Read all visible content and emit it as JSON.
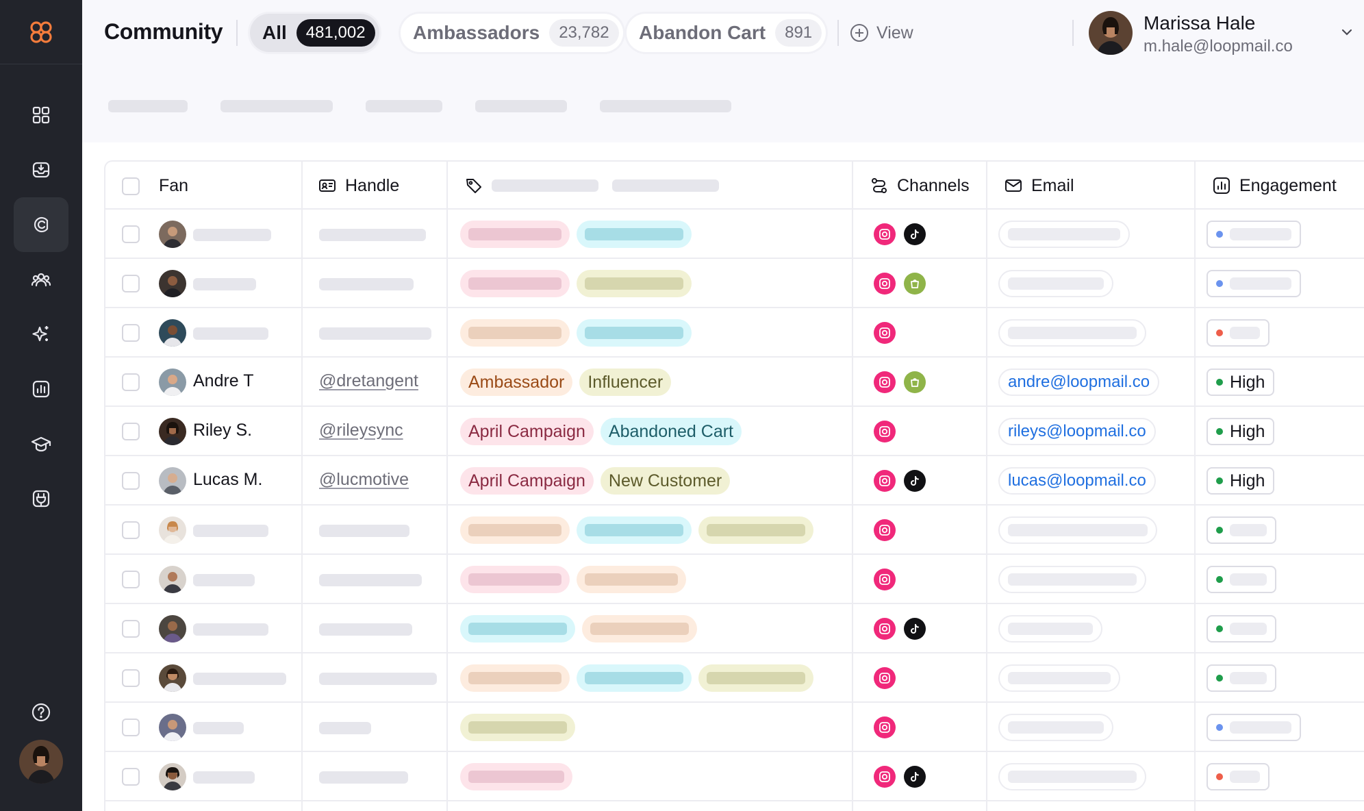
{
  "header": {
    "title": "Community",
    "tabs": [
      {
        "label": "All",
        "count": "481,002"
      },
      {
        "label": "Ambassadors",
        "count": "23,782"
      },
      {
        "label": "Abandon Cart",
        "count": "891"
      }
    ],
    "view_label": "View"
  },
  "user": {
    "name": "Marissa Hale",
    "email": "m.hale@loopmail.co"
  },
  "table": {
    "columns": {
      "fan": "Fan",
      "handle": "Handle",
      "channels": "Channels",
      "email": "Email",
      "engagement": "Engagement"
    },
    "rows": [
      {
        "name": "Andre T",
        "handle": "@dretangent",
        "tags": [
          "Ambassador",
          "Influencer"
        ],
        "email": "andre@loopmail.co",
        "engagement": "High"
      },
      {
        "name": "Riley S.",
        "handle": "@rileysync",
        "tags": [
          "April Campaign",
          "Abandoned Cart"
        ],
        "email": "rileys@loopmail.co",
        "engagement": "High"
      },
      {
        "name": "Lucas M.",
        "handle": "@lucmotive",
        "tags": [
          "April Campaign",
          "New Customer"
        ],
        "email": "lucas@loopmail.co",
        "engagement": "High"
      }
    ]
  },
  "colors": {
    "sidebar": "#22242b",
    "brand": "#f47c3c",
    "instagram": "#f0287a",
    "tiktok": "#111114",
    "shopify": "#8fb449",
    "link": "#1f6fe0"
  },
  "icons": {
    "sidebar": [
      "dashboard-icon",
      "inbox-icon",
      "campaigns-icon",
      "community-icon",
      "sparkle-icon",
      "analytics-icon",
      "learn-icon",
      "integrations-icon",
      "help-icon"
    ]
  }
}
